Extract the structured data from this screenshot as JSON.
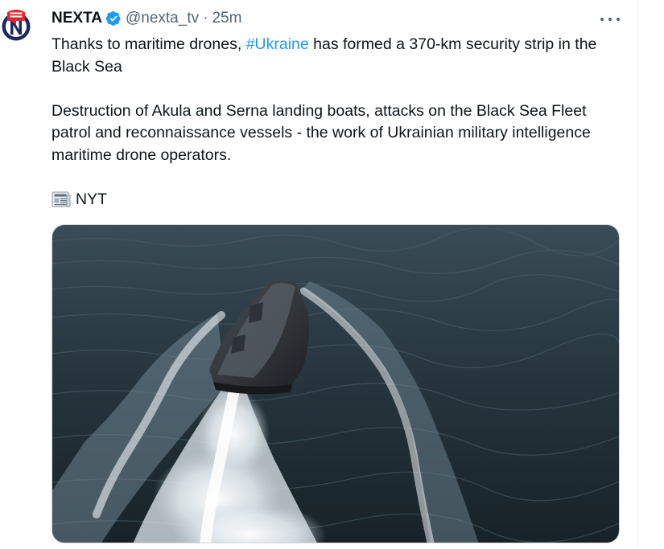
{
  "author": {
    "name": "NEXTA",
    "handle": "@nexta_tv",
    "separator": "·",
    "time": "25m",
    "avatar_icon": "nexta-logo-icon",
    "verified_icon": "verified-badge-icon",
    "verified_color": "#1d9bf0"
  },
  "tweet": {
    "line1_prefix": "Thanks to maritime drones, ",
    "hashtag": "#Ukraine",
    "line1_suffix": " has formed a 370-km security strip in the Black Sea",
    "paragraph2": "Destruction of Akula and Serna landing boats, attacks on the Black Sea Fleet patrol and reconnaissance vessels - the work of Ukrainian military intelligence maritime drone operators.",
    "source_icon": "newspaper-icon",
    "source": "NYT"
  },
  "media": {
    "description_icon": "sea-drone-photo"
  },
  "menu": {
    "icon": "more-options-icon"
  },
  "colors": {
    "text": "#0f1419",
    "secondary": "#536471",
    "link": "#1d9bf0",
    "brand_red": "#e2262e",
    "brand_navy": "#1b2a5c"
  }
}
